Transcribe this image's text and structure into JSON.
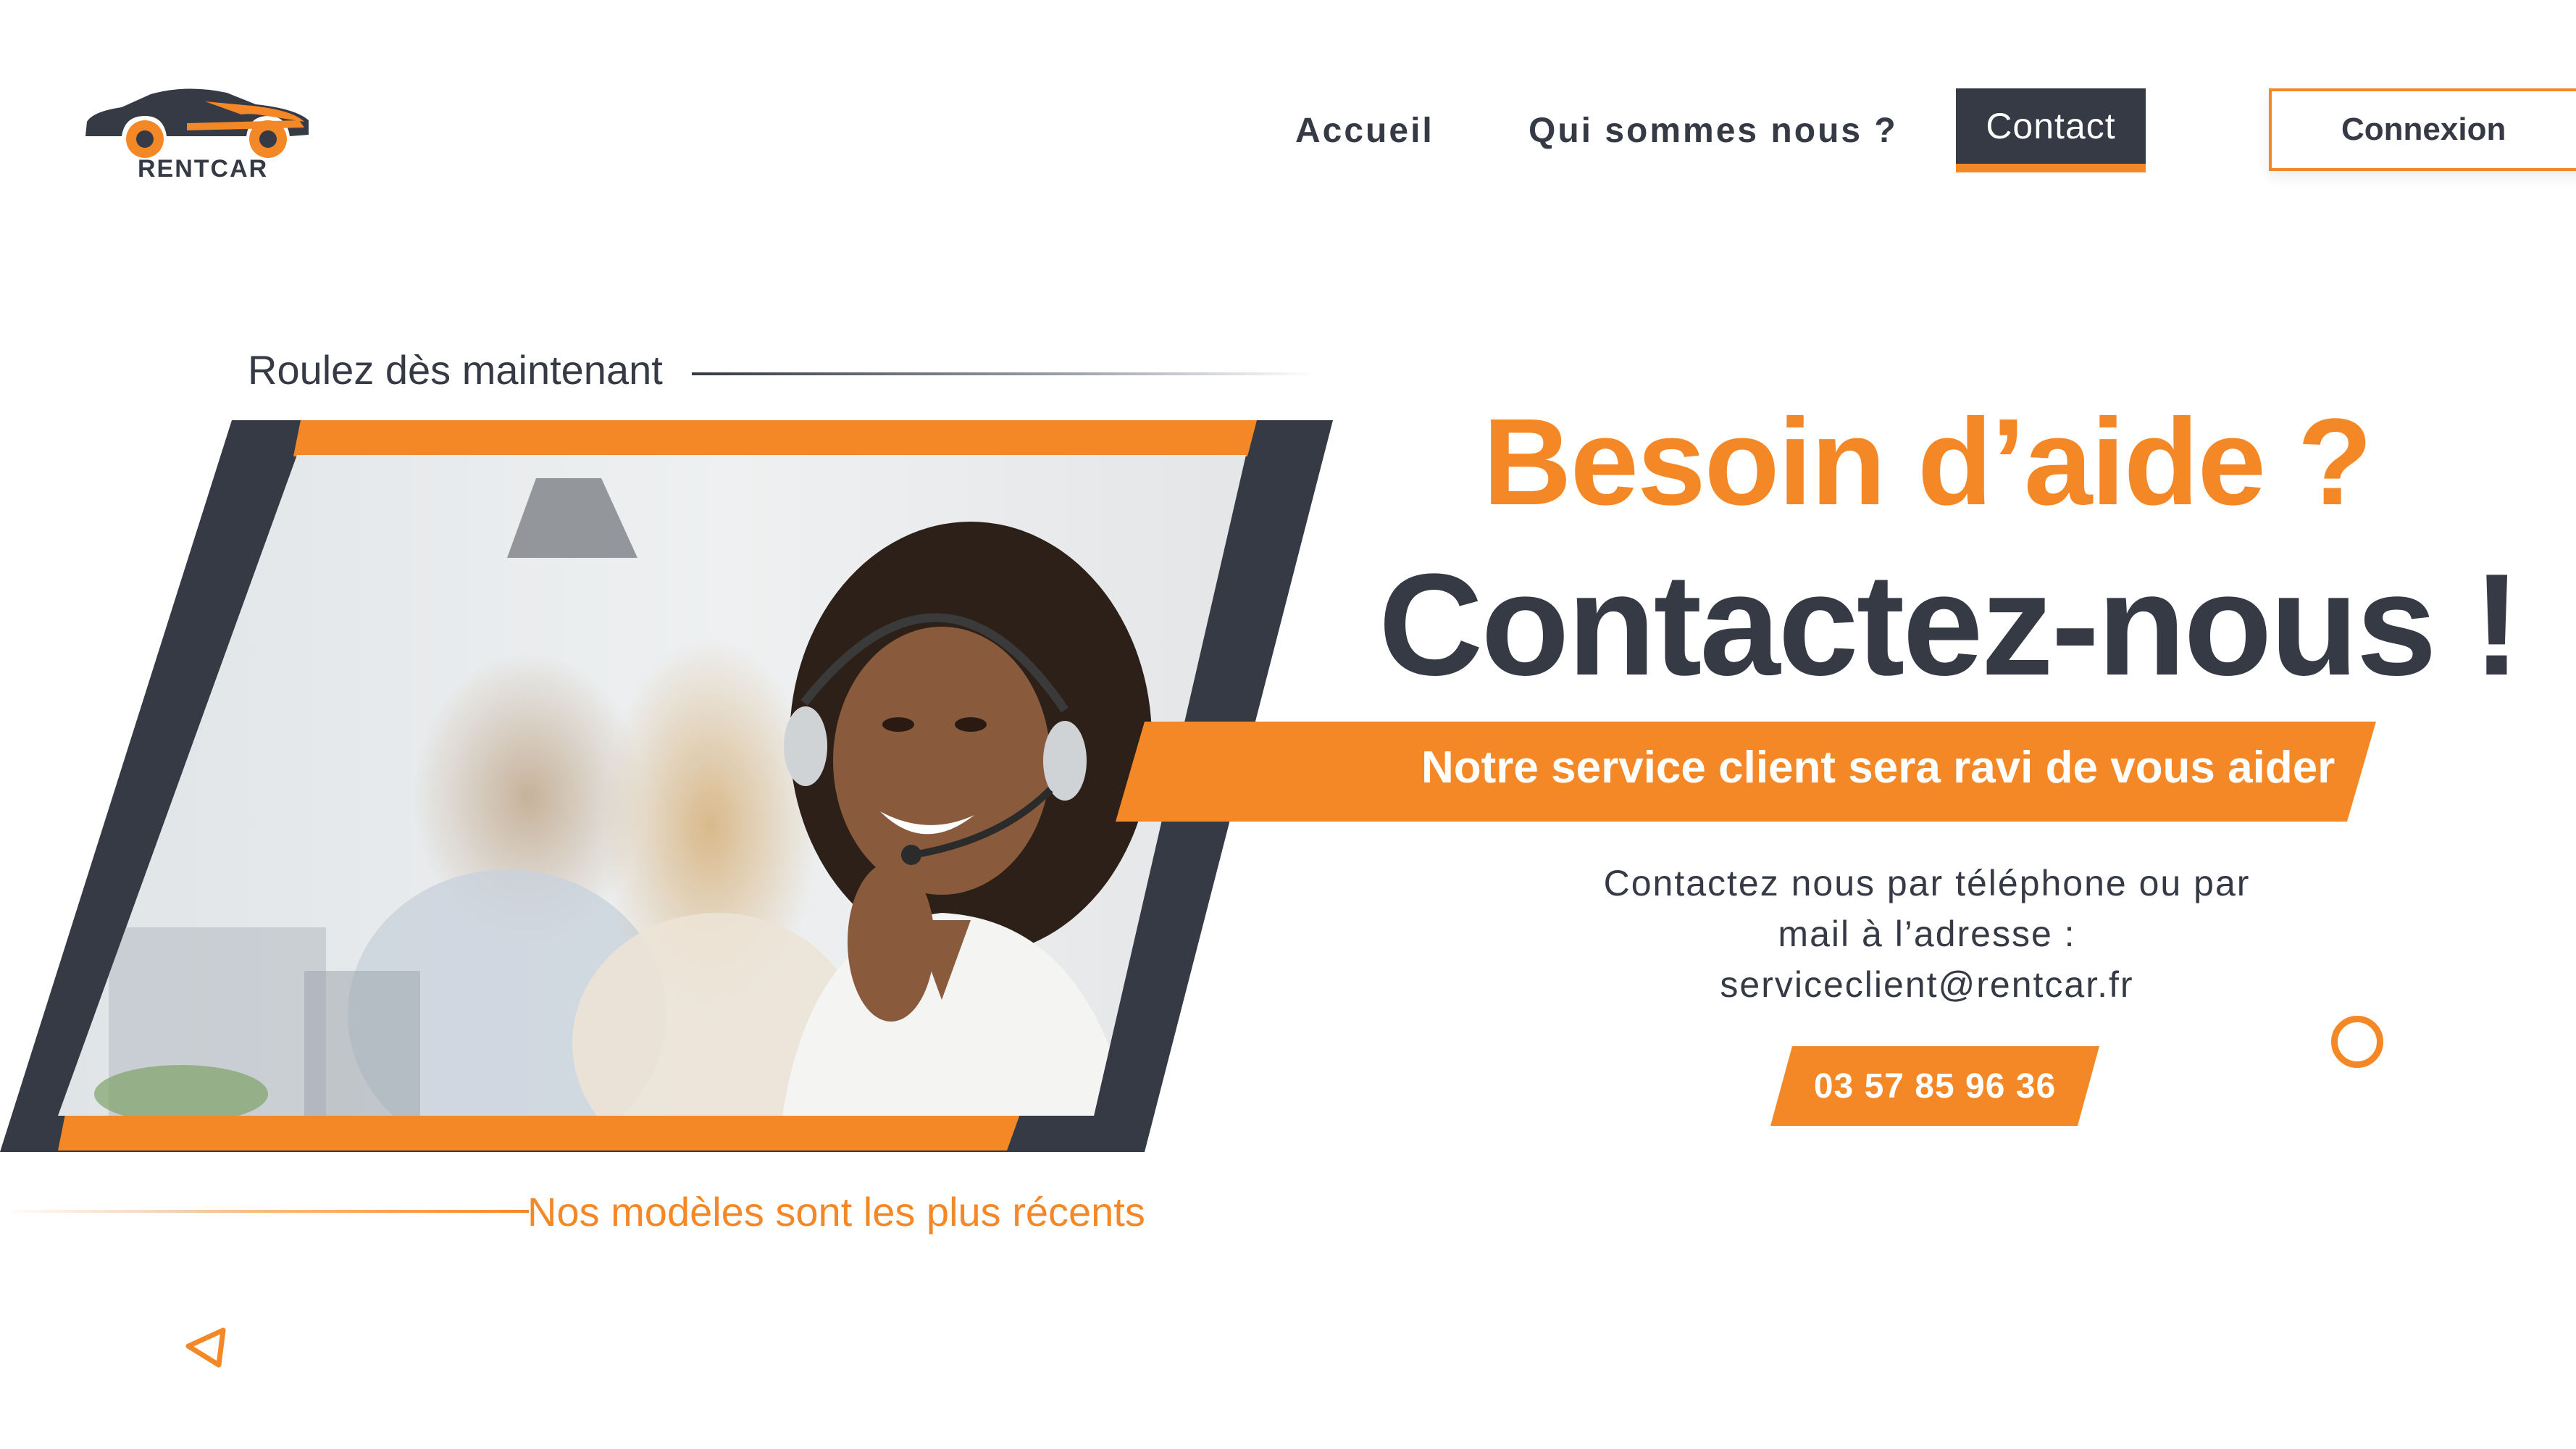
{
  "brand": {
    "name": "RENTCAR"
  },
  "nav": {
    "items": [
      {
        "label": "Accueil"
      },
      {
        "label": "Qui sommes nous ?"
      },
      {
        "label": "Contact"
      }
    ],
    "active_item": "Contact",
    "login_label": "Connexion"
  },
  "hero": {
    "tagline_top": "Roulez dès maintenant",
    "tagline_bottom": "Nos modèles sont les plus récents",
    "image_description_icon": "call-center-agent-photo",
    "heading_line1": "Besoin d’aide ?",
    "heading_line2": "Contactez-nous !",
    "banner_text": "Notre service client sera ravi de vous aider",
    "contact_text_line1": "Contactez nous par téléphone ou par",
    "contact_text_line2": "mail à l’adresse :",
    "contact_email": "serviceclient@rentcar.fr",
    "phone": "03 57 85 96 36"
  },
  "colors": {
    "accent": "#f58826",
    "dark": "#353a45",
    "background": "#ffffff"
  }
}
